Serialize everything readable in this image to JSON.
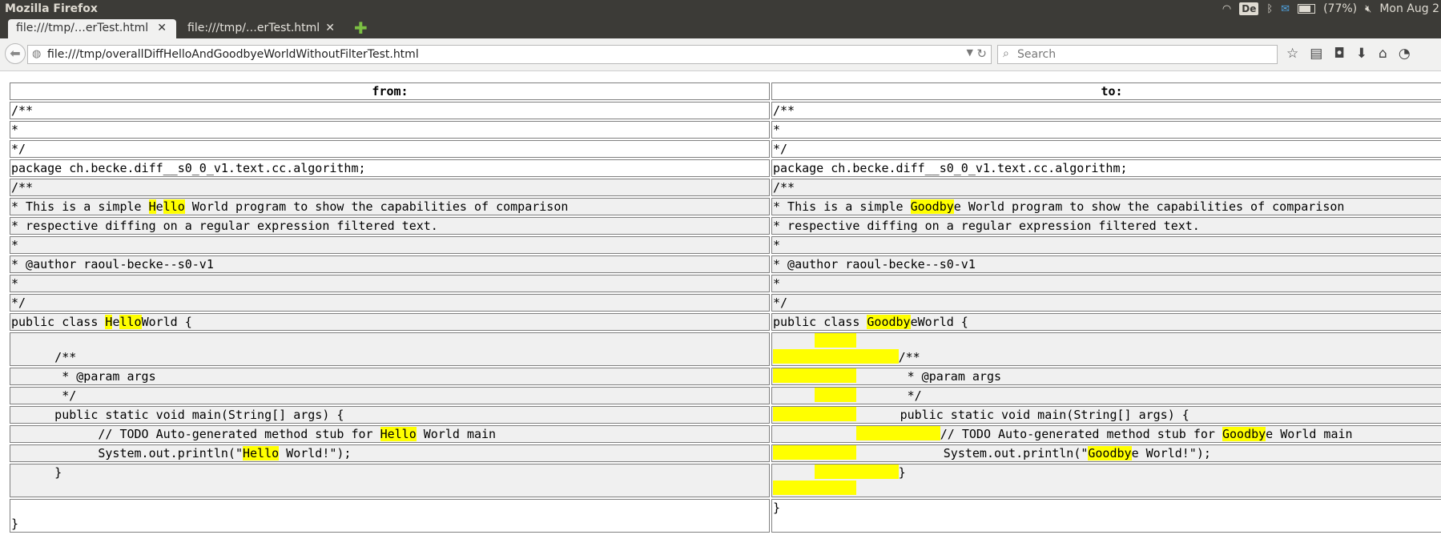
{
  "window": {
    "title": "Mozilla Firefox",
    "tray": {
      "keyboard": "De",
      "battery": "(77%)",
      "clock": "Mon Aug 2"
    }
  },
  "tabs": [
    {
      "label": "file:///tmp/…erTest.html"
    },
    {
      "label": "file:///tmp/…erTest.html"
    }
  ],
  "nav": {
    "url": "file:///tmp/overallDiffHelloAndGoodbyeWorldWithoutFilterTest.html",
    "search_placeholder": "Search"
  },
  "diff": {
    "from_header": "from:",
    "to_header": "to:",
    "rows": [
      {
        "type": "eq",
        "from": [
          [
            {
              "t": "/**"
            }
          ]
        ],
        "to": [
          [
            {
              "t": "/**"
            }
          ]
        ]
      },
      {
        "type": "eq",
        "from": [
          [
            {
              "t": "*"
            }
          ]
        ],
        "to": [
          [
            {
              "t": "*"
            }
          ]
        ]
      },
      {
        "type": "eq",
        "from": [
          [
            {
              "t": "*/"
            }
          ]
        ],
        "to": [
          [
            {
              "t": "*/"
            }
          ]
        ]
      },
      {
        "type": "eq",
        "from": [
          [
            {
              "t": "package ch.becke.diff__s0_0_v1.text.cc.algorithm;"
            }
          ]
        ],
        "to": [
          [
            {
              "t": "package ch.becke.diff__s0_0_v1.text.cc.algorithm;"
            }
          ]
        ]
      },
      {
        "type": "df",
        "from": [
          [
            {
              "t": "/**"
            }
          ]
        ],
        "to": [
          [
            {
              "t": "/**"
            }
          ]
        ]
      },
      {
        "type": "df",
        "from": [
          [
            {
              "t": "* This is a simple "
            },
            {
              "t": "H",
              "h": 1
            },
            {
              "t": "e"
            },
            {
              "t": "llo",
              "h": 1
            },
            {
              "t": " World program to show the capabilities of comparison"
            }
          ]
        ],
        "to": [
          [
            {
              "t": "* This is a simple "
            },
            {
              "t": "Goodby",
              "h": 1
            },
            {
              "t": "e World program to show the capabilities of comparison"
            }
          ]
        ]
      },
      {
        "type": "df",
        "from": [
          [
            {
              "t": "* respective diffing on a regular expression filtered text."
            }
          ]
        ],
        "to": [
          [
            {
              "t": "* respective diffing on a regular expression filtered text."
            }
          ]
        ]
      },
      {
        "type": "df",
        "from": [
          [
            {
              "t": "*"
            }
          ]
        ],
        "to": [
          [
            {
              "t": "*"
            }
          ]
        ]
      },
      {
        "type": "df",
        "from": [
          [
            {
              "t": "* @author raoul-becke--s0-v1"
            }
          ]
        ],
        "to": [
          [
            {
              "t": "* @author raoul-becke--s0-v1"
            }
          ]
        ]
      },
      {
        "type": "df",
        "from": [
          [
            {
              "t": "*"
            }
          ]
        ],
        "to": [
          [
            {
              "t": "*"
            }
          ]
        ]
      },
      {
        "type": "df",
        "from": [
          [
            {
              "t": "*/"
            }
          ]
        ],
        "to": [
          [
            {
              "t": "*/"
            }
          ]
        ]
      },
      {
        "type": "df",
        "from": [
          [
            {
              "t": "public class "
            },
            {
              "t": "H",
              "h": 1
            },
            {
              "t": "e"
            },
            {
              "t": "llo",
              "h": 1
            },
            {
              "t": "World {"
            }
          ]
        ],
        "to": [
          [
            {
              "t": "public class "
            },
            {
              "t": "Goodby",
              "h": 1
            },
            {
              "t": "eWorld {"
            }
          ]
        ]
      },
      {
        "type": "df",
        "from": [
          [
            {
              "t": ""
            }
          ],
          [
            {
              "t": "      /**"
            }
          ]
        ],
        "to": [
          [
            {
              "sp": 6
            },
            {
              "g": 6
            }
          ],
          [
            {
              "g": 18
            },
            {
              "t": "/**"
            }
          ]
        ]
      },
      {
        "type": "df",
        "from": [
          [
            {
              "t": "       * @param args"
            }
          ]
        ],
        "to": [
          [
            {
              "g": 12
            },
            {
              "t": "       * @param args"
            }
          ]
        ]
      },
      {
        "type": "df",
        "from": [
          [
            {
              "t": "       */"
            }
          ]
        ],
        "to": [
          [
            {
              "sp": 6
            },
            {
              "g": 6
            },
            {
              "t": "       */"
            }
          ]
        ]
      },
      {
        "type": "df",
        "from": [
          [
            {
              "t": "      public static void main(String[] args) {"
            }
          ]
        ],
        "to": [
          [
            {
              "g": 12
            },
            {
              "t": "      public static void main(String[] args) {"
            }
          ]
        ]
      },
      {
        "type": "df",
        "from": [
          [
            {
              "t": "            // TODO Auto-generated method stub for "
            },
            {
              "t": "He",
              "h": 1
            },
            {
              "t": "llo",
              "h": 1
            },
            {
              "t": " World main"
            }
          ]
        ],
        "to": [
          [
            {
              "sp": 12
            },
            {
              "g": 12
            },
            {
              "t": "// TODO Auto-generated method stub for "
            },
            {
              "t": "Goodby",
              "h": 1
            },
            {
              "t": "e World main"
            }
          ]
        ]
      },
      {
        "type": "df",
        "from": [
          [
            {
              "t": "            System.out.println(\""
            },
            {
              "t": "He",
              "h": 1
            },
            {
              "t": "llo",
              "h": 1
            },
            {
              "t": " World!\");"
            }
          ]
        ],
        "to": [
          [
            {
              "g": 12
            },
            {
              "t": "            System.out.println(\""
            },
            {
              "t": "Goodby",
              "h": 1
            },
            {
              "t": "e World!\");"
            }
          ]
        ]
      },
      {
        "type": "df",
        "from": [
          [
            {
              "t": "      }"
            }
          ],
          [
            {
              "t": ""
            }
          ]
        ],
        "to": [
          [
            {
              "sp": 6
            },
            {
              "g": 12
            },
            {
              "t": "}"
            }
          ],
          [
            {
              "g": 12
            }
          ]
        ]
      },
      {
        "type": "eq",
        "from": [
          [
            {
              "t": ""
            }
          ],
          [
            {
              "t": "}"
            }
          ]
        ],
        "to": [
          [
            {
              "t": "}"
            }
          ]
        ]
      }
    ]
  }
}
